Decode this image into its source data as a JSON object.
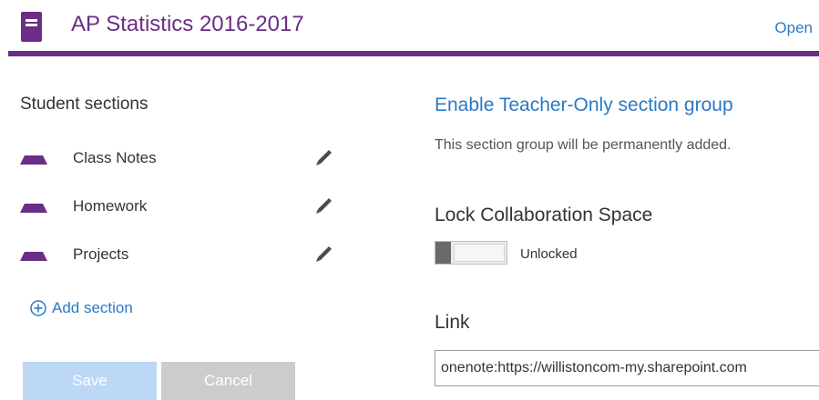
{
  "header": {
    "notebook_title": "AP Statistics 2016-2017",
    "open_label": "Open",
    "notebook_icon": "onenote-notebook-icon"
  },
  "colors": {
    "accent_purple": "#6b2d85",
    "link_blue": "#2b78c5",
    "save_button_bg": "#bcd8f5",
    "cancel_button_bg": "#cccccc"
  },
  "student_sections": {
    "heading": "Student sections",
    "items": [
      {
        "label": "Class Notes",
        "icon": "section-tab-icon",
        "edit_icon": "pencil-icon"
      },
      {
        "label": "Homework",
        "icon": "section-tab-icon",
        "edit_icon": "pencil-icon"
      },
      {
        "label": "Projects",
        "icon": "section-tab-icon",
        "edit_icon": "pencil-icon"
      }
    ],
    "add_section_label": "Add section",
    "add_icon": "plus-circle-icon"
  },
  "buttons": {
    "save_label": "Save",
    "cancel_label": "Cancel"
  },
  "teacher_only": {
    "link_label": "Enable Teacher-Only section group",
    "description": "This section group will be permanently added."
  },
  "collaboration": {
    "heading": "Lock Collaboration Space",
    "toggle_state": "Unlocked",
    "locked": false
  },
  "link": {
    "heading": "Link",
    "value": "onenote:https://willistoncom-my.sharepoint.com"
  }
}
